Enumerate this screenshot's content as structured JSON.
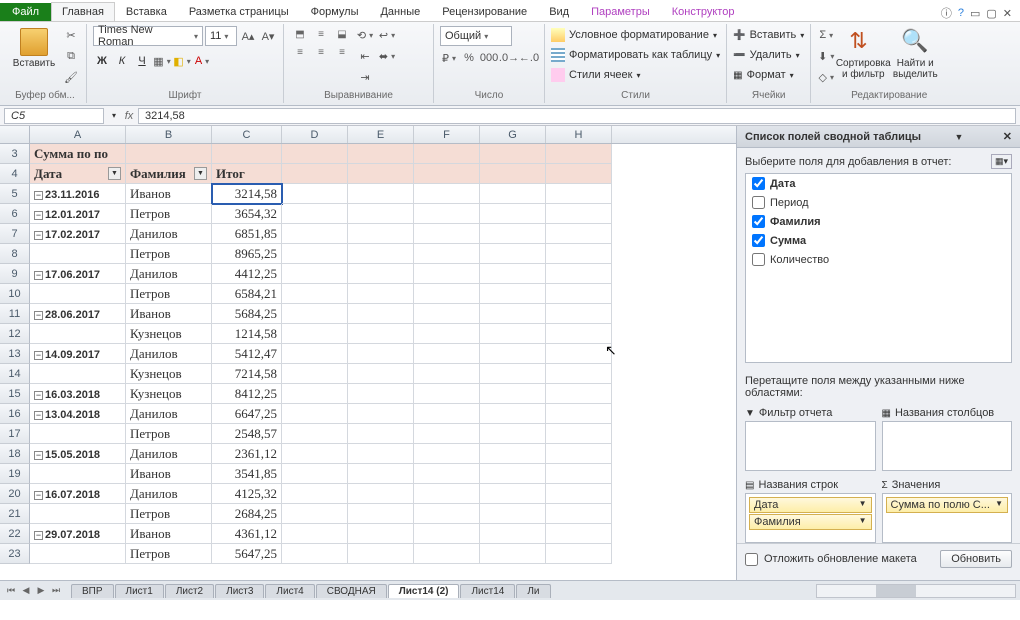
{
  "tabs": {
    "file": "Файл",
    "home": "Главная",
    "insert": "Вставка",
    "page": "Разметка страницы",
    "formulas": "Формулы",
    "data": "Данные",
    "review": "Рецензирование",
    "view": "Вид",
    "params": "Параметры",
    "design": "Конструктор"
  },
  "groups": {
    "clipboard": "Буфер обм...",
    "font": "Шрифт",
    "align": "Выравнивание",
    "number": "Число",
    "styles": "Стили",
    "cells": "Ячейки",
    "editing": "Редактирование"
  },
  "font": {
    "name": "Times New Roman",
    "size": "11"
  },
  "number_format": "Общий",
  "style_items": {
    "cond": "Условное форматирование",
    "table": "Форматировать как таблицу",
    "cell": "Стили ячеек"
  },
  "cell_items": {
    "insert": "Вставить",
    "delete": "Удалить",
    "format": "Формат"
  },
  "big": {
    "paste": "Вставить",
    "sort": "Сортировка и фильтр",
    "find": "Найти и выделить"
  },
  "namebox": "C5",
  "formula": "3214,58",
  "cols": [
    "A",
    "B",
    "C",
    "D",
    "E",
    "F",
    "G",
    "H"
  ],
  "widths": [
    96,
    86,
    70,
    66,
    66,
    66,
    66,
    66
  ],
  "pivot": {
    "title_cell": "Сумма по по",
    "headers": [
      "Дата",
      "Фамилия",
      "Итог"
    ]
  },
  "rows": [
    {
      "n": 3,
      "a": "Сумма по по",
      "hdr": true
    },
    {
      "n": 4,
      "a": "Дата",
      "b": "Фамилия",
      "c": "Итог",
      "hdr": true,
      "filters": true
    },
    {
      "n": 5,
      "a": "23.11.2016",
      "b": "Иванов",
      "c": "3214,58",
      "col": true,
      "sel": true
    },
    {
      "n": 6,
      "a": "12.01.2017",
      "b": "Петров",
      "c": "3654,32",
      "col": true
    },
    {
      "n": 7,
      "a": "17.02.2017",
      "b": "Данилов",
      "c": "6851,85",
      "col": true
    },
    {
      "n": 8,
      "b": "Петров",
      "c": "8965,25"
    },
    {
      "n": 9,
      "a": "17.06.2017",
      "b": "Данилов",
      "c": "4412,25",
      "col": true
    },
    {
      "n": 10,
      "b": "Петров",
      "c": "6584,21"
    },
    {
      "n": 11,
      "a": "28.06.2017",
      "b": "Иванов",
      "c": "5684,25",
      "col": true
    },
    {
      "n": 12,
      "b": "Кузнецов",
      "c": "1214,58"
    },
    {
      "n": 13,
      "a": "14.09.2017",
      "b": "Данилов",
      "c": "5412,47",
      "col": true
    },
    {
      "n": 14,
      "b": "Кузнецов",
      "c": "7214,58"
    },
    {
      "n": 15,
      "a": "16.03.2018",
      "b": "Кузнецов",
      "c": "8412,25",
      "col": true
    },
    {
      "n": 16,
      "a": "13.04.2018",
      "b": "Данилов",
      "c": "6647,25",
      "col": true
    },
    {
      "n": 17,
      "b": "Петров",
      "c": "2548,57"
    },
    {
      "n": 18,
      "a": "15.05.2018",
      "b": "Данилов",
      "c": "2361,12",
      "col": true
    },
    {
      "n": 19,
      "b": "Иванов",
      "c": "3541,85"
    },
    {
      "n": 20,
      "a": "16.07.2018",
      "b": "Данилов",
      "c": "4125,32",
      "col": true
    },
    {
      "n": 21,
      "b": "Петров",
      "c": "2684,25"
    },
    {
      "n": 22,
      "a": "29.07.2018",
      "b": "Иванов",
      "c": "4361,12",
      "col": true
    },
    {
      "n": 23,
      "b": "Петров",
      "c": "5647,25"
    }
  ],
  "pane": {
    "title": "Список полей сводной таблицы",
    "choose": "Выберите поля для добавления в отчет:",
    "fields": [
      {
        "label": "Дата",
        "checked": true
      },
      {
        "label": "Период",
        "checked": false
      },
      {
        "label": "Фамилия",
        "checked": true
      },
      {
        "label": "Сумма",
        "checked": true
      },
      {
        "label": "Количество",
        "checked": false
      }
    ],
    "drag": "Перетащите поля между указанными ниже областями:",
    "areas": {
      "filter": "Фильтр отчета",
      "cols": "Названия столбцов",
      "rows": "Названия строк",
      "vals": "Значения"
    },
    "row_items": [
      "Дата",
      "Фамилия"
    ],
    "val_items": [
      "Сумма по полю С..."
    ],
    "defer": "Отложить обновление макета",
    "update": "Обновить"
  },
  "sheets": [
    "ВПР",
    "Лист1",
    "Лист2",
    "Лист3",
    "Лист4",
    "СВОДНАЯ",
    "Лист14 (2)",
    "Лист14",
    "Ли"
  ]
}
